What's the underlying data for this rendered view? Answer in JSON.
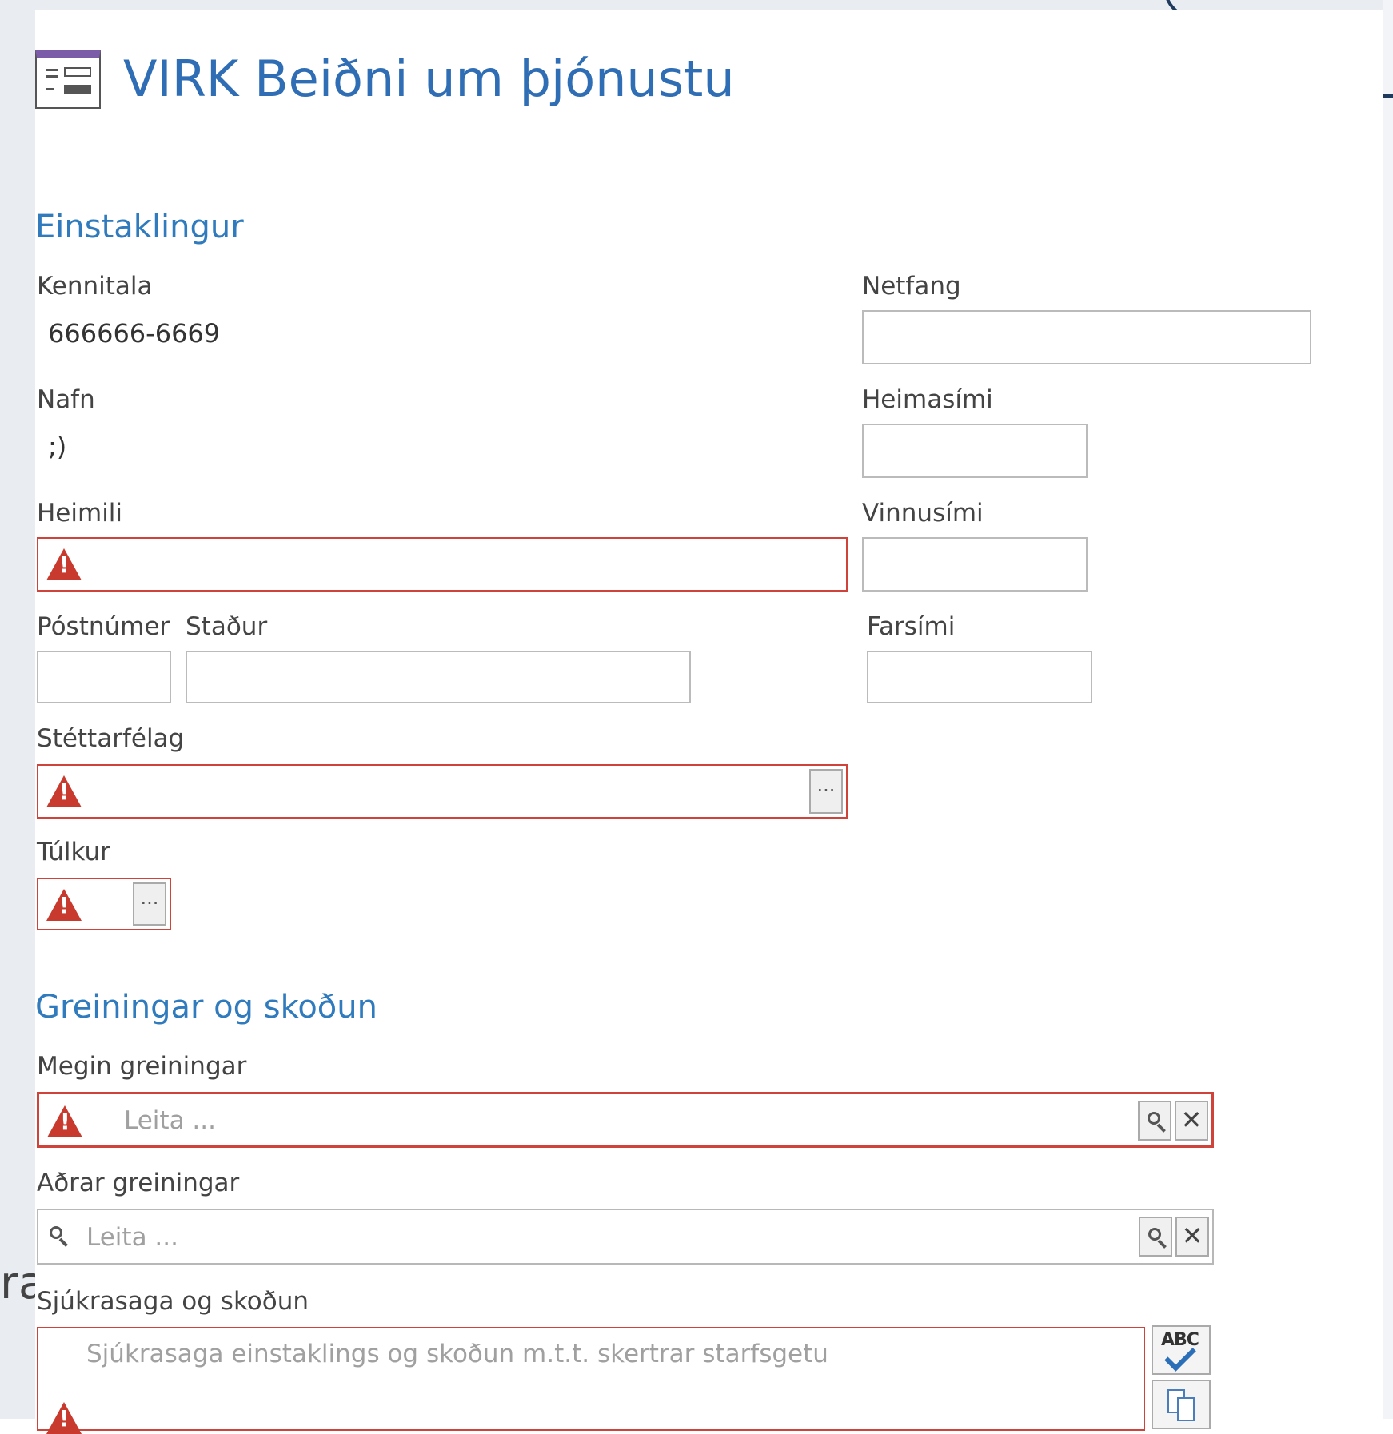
{
  "form": {
    "title": "VIRK Beiðni um þjónustu"
  },
  "background": {
    "partial_text": "ra"
  },
  "einstaklingur": {
    "heading": "Einstaklingur",
    "kennitala": {
      "label": "Kennitala",
      "value": "666666-6669"
    },
    "nafn": {
      "label": "Nafn",
      "value": ";)"
    },
    "heimili": {
      "label": "Heimili",
      "value": ""
    },
    "postnumer": {
      "label": "Póstnúmer",
      "value": ""
    },
    "stadur": {
      "label": "Staður",
      "value": ""
    },
    "stettarfelag": {
      "label": "Stéttarfélag",
      "value": "",
      "button": "···"
    },
    "tulkur": {
      "label": "Túlkur",
      "value": "",
      "button": "···"
    },
    "netfang": {
      "label": "Netfang",
      "value": ""
    },
    "heimasimi": {
      "label": "Heimasími",
      "value": ""
    },
    "vinnusimi": {
      "label": "Vinnusími",
      "value": ""
    },
    "farsimi": {
      "label": "Farsími",
      "value": ""
    }
  },
  "greiningar": {
    "heading": "Greiningar og skoðun",
    "megin": {
      "label": "Megin greiningar",
      "placeholder": "Leita ...",
      "clear": "✕"
    },
    "adrar": {
      "label": "Aðrar greiningar",
      "placeholder": "Leita ...",
      "clear": "✕"
    },
    "sjukrasaga": {
      "label": "Sjúkrasaga og skoðun",
      "placeholder": "Sjúkrasaga einstaklings og skoðun m.t.t. skertrar starfsgetu",
      "spell_button": "ABC"
    }
  },
  "colors": {
    "title": "#2f6eb5",
    "section": "#2f7bbd",
    "error_border": "#d0433a",
    "warning_icon": "#c83a2e",
    "form_icon_accent": "#7b5ca8"
  },
  "icons": [
    "form-icon",
    "warning-icon",
    "ellipsis-icon",
    "search-icon",
    "clear-icon",
    "spellcheck-icon",
    "copy-icon"
  ]
}
